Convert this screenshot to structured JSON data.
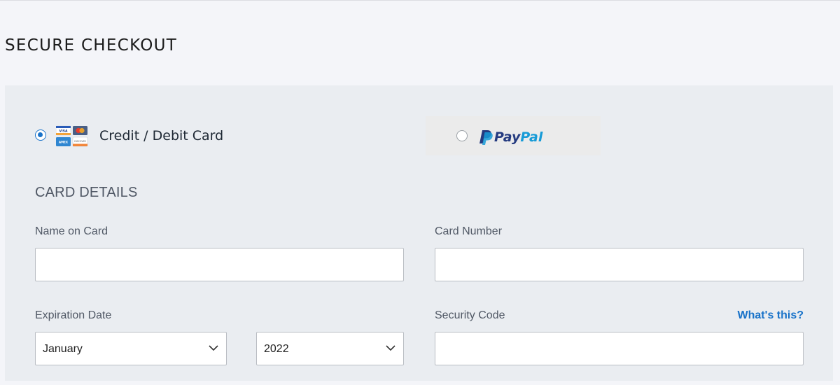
{
  "page": {
    "title": "SECURE CHECKOUT"
  },
  "payment_methods": [
    {
      "id": "card",
      "label": "Credit / Debit Card",
      "selected": true,
      "icon": "credit-card-brands-icon"
    },
    {
      "id": "paypal",
      "label": "PayPal",
      "selected": false,
      "icon": "paypal-logo"
    }
  ],
  "card_details": {
    "title": "CARD DETAILS",
    "name_on_card": {
      "label": "Name on Card",
      "value": "",
      "placeholder": ""
    },
    "card_number": {
      "label": "Card Number",
      "value": "",
      "placeholder": ""
    },
    "expiration": {
      "label": "Expiration Date",
      "month": "January",
      "year": "2022"
    },
    "security_code": {
      "label": "Security Code",
      "help_link": "What's this?",
      "value": "",
      "placeholder": ""
    }
  },
  "colors": {
    "accent": "#1a73c9",
    "paypal_dark": "#253b80",
    "paypal_light": "#179bd7",
    "panel_bg": "#eaedf1",
    "page_bg": "#f4f5f9"
  }
}
